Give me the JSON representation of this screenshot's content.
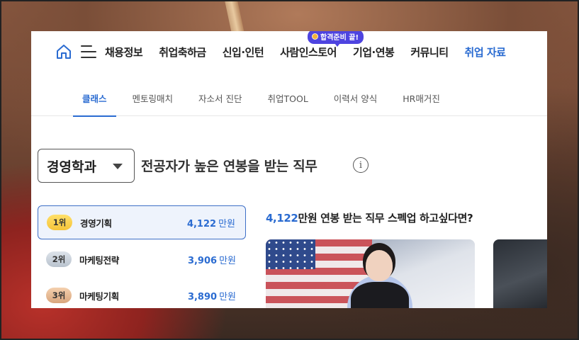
{
  "top_nav": {
    "items": [
      {
        "label": "채용정보"
      },
      {
        "label": "취업축하금"
      },
      {
        "label": "신입·인턴"
      },
      {
        "label": "사람인스토어"
      },
      {
        "label": "기업·연봉"
      },
      {
        "label": "커뮤니티"
      },
      {
        "label": "취업 자료"
      }
    ],
    "promo_badge": "합격준비 끝!"
  },
  "sub_nav": {
    "items": [
      {
        "label": "클래스"
      },
      {
        "label": "멘토링매치"
      },
      {
        "label": "자소서 진단"
      },
      {
        "label": "취업TOOL"
      },
      {
        "label": "이력서 양식"
      },
      {
        "label": "HR매거진"
      }
    ]
  },
  "department_select": {
    "value": "경영학과"
  },
  "headline": "전공자가 높은 연봉을 받는 직무",
  "info_icon_glyph": "i",
  "ranking": [
    {
      "rank": "1위",
      "job": "경영기획",
      "salary": "4,122",
      "unit": "만원"
    },
    {
      "rank": "2위",
      "job": "마케팅전략",
      "salary": "3,906",
      "unit": "만원"
    },
    {
      "rank": "3위",
      "job": "마케팅기획",
      "salary": "3,890",
      "unit": "만원"
    }
  ],
  "recommend": {
    "amount": "4,122",
    "text": "만원 연봉 받는 직무 스펙업 하고싶다면?"
  },
  "colors": {
    "accent": "#2a6bd1",
    "promo": "#4e44e0",
    "selected_bg": "#eef3fc"
  }
}
